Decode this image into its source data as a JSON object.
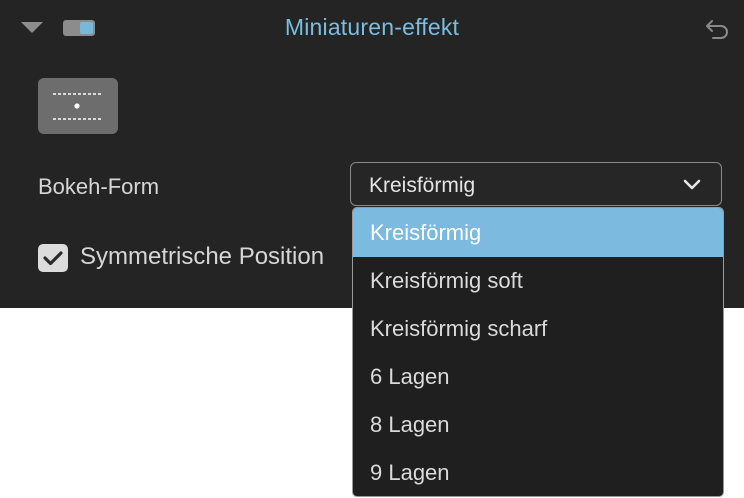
{
  "panel": {
    "title": "Miniaturen-effekt",
    "icons": {
      "collapse": "triangle-down-icon",
      "toggle": "toggle-switch-icon",
      "reset": "undo-arrow-icon",
      "mode": "dotted-lines-mode-icon"
    }
  },
  "bokeh": {
    "label": "Bokeh-Form",
    "selected_value": "Kreisförmig",
    "options": [
      "Kreisförmig",
      "Kreisförmig soft",
      "Kreisförmig scharf",
      "6 Lagen",
      "8 Lagen",
      "9 Lagen"
    ]
  },
  "symmetric": {
    "label": "Symmetrische Position",
    "checked": true
  },
  "colors": {
    "panel_bg": "#242424",
    "accent": "#7dbadf",
    "title": "#7bbde0"
  }
}
